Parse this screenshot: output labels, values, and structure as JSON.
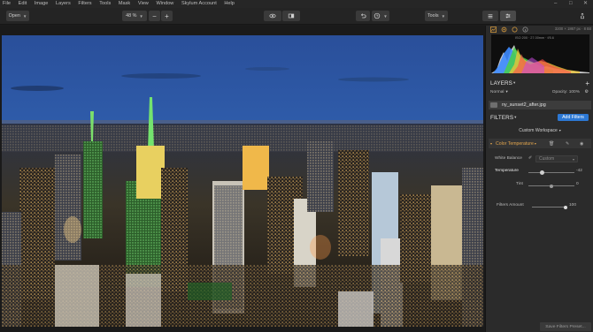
{
  "menu": [
    "File",
    "Edit",
    "Image",
    "Layers",
    "Filters",
    "Tools",
    "Mask",
    "View",
    "Window",
    "Skylum Account",
    "Help"
  ],
  "window_controls": {
    "minimize": "–",
    "maximize": "□",
    "close": "✕"
  },
  "toolbar": {
    "open_label": "Open",
    "zoom_value": "48 %",
    "zoom_out": "−",
    "zoom_in": "+",
    "tools_label": "Tools"
  },
  "panel": {
    "image_info": "3200 × 1867 px · 8 Bit",
    "exif": "ISO 200 · 27.00mm · f/5.6",
    "layers_title": "LAYERS",
    "add_layer": "+",
    "blend_mode": "Normal",
    "opacity_label": "Opacity: 100%",
    "layer_name": "ny_sunset2_after.jpg",
    "filters_title": "FILTERS",
    "add_filters": "Add Filters",
    "workspace": "Custom Workspace",
    "filter_name": "Color Temperature",
    "white_balance_label": "White Balance",
    "white_balance_value": "Custom",
    "temperature_label": "Temperature",
    "temperature_value": "-42",
    "temperature_level": 0.29,
    "tint_label": "Tint",
    "tint_value": "0",
    "tint_level": 0.5,
    "amount_label": "Filters Amount",
    "amount_value": "100",
    "amount_level": 1.0,
    "save_preset": "Save Filters Preset..."
  },
  "colors": {
    "accent": "#2c78d4",
    "filter_title": "#e2a54d",
    "panel_bg": "#2b2b2b"
  }
}
